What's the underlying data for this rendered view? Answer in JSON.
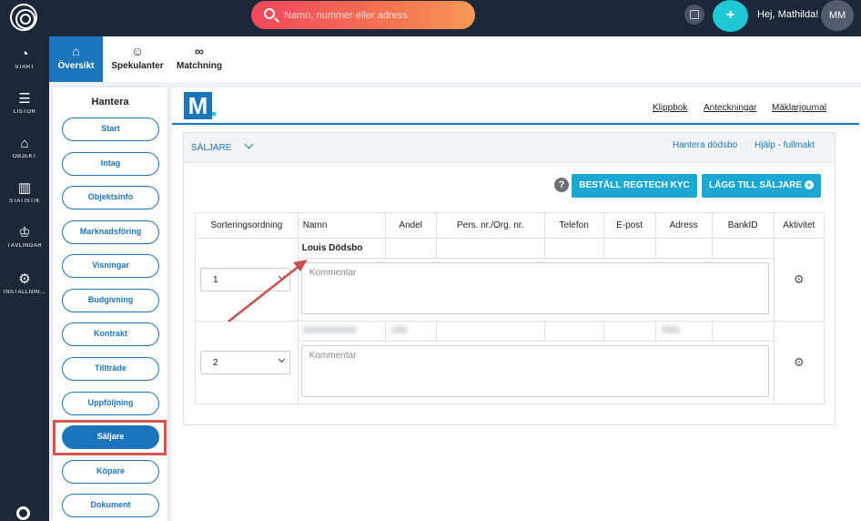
{
  "search": {
    "placeholder": "Namn, nummer eller adress"
  },
  "header": {
    "greeting": "Hej, Mathilda!",
    "initials": "MM",
    "add_label": "+"
  },
  "leftnav": [
    {
      "label": "START",
      "icon": "gauge-icon"
    },
    {
      "label": "LISTOR",
      "icon": "list-icon"
    },
    {
      "label": "OBJEKT",
      "icon": "house-icon"
    },
    {
      "label": "STATISTIK",
      "icon": "bar-chart-icon"
    },
    {
      "label": "TÄVLINGAR",
      "icon": "trophy-icon"
    },
    {
      "label": "INSTÄLLNIN...",
      "icon": "gear-icon"
    }
  ],
  "tabs": [
    {
      "label": "Översikt",
      "active": true
    },
    {
      "label": "Spekulanter"
    },
    {
      "label": "Matchning"
    }
  ],
  "hantera": {
    "title": "Hantera",
    "items": [
      "Start",
      "Intag",
      "Objektsinfo",
      "Marknadsföring",
      "Visningar",
      "Budgivning",
      "Kontrakt",
      "Tillträde",
      "Uppföljning",
      "Säljare",
      "Köpare",
      "Dokument"
    ],
    "active": "Säljare"
  },
  "main": {
    "logo": "M",
    "links": [
      "Klippbok",
      "Anteckningar",
      "Mäklarjournal"
    ],
    "card_title": "SÄLJARE",
    "head_links": [
      "Hantera dödsbo",
      "Hjälp - fullmakt"
    ],
    "buttons": {
      "kyc": "BESTÄLL REGTECH KYC",
      "add": "LÄGG TILL SÄLJARE"
    },
    "columns": [
      "Sorteringsordning",
      "Namn",
      "Andel",
      "Pers. nr./Org. nr.",
      "Telefon",
      "E-post",
      "Adress",
      "BankID",
      "Aktivitet"
    ],
    "rows": [
      {
        "order": "1",
        "name": "Louis Dödsbo",
        "comment_placeholder": "Kommentar"
      },
      {
        "order": "2",
        "name": "",
        "comment_placeholder": "Kommentar"
      }
    ]
  },
  "colors": {
    "primary": "#1c74bb",
    "button": "#1ca8d4",
    "nav": "#1c2738",
    "highlight": "#d9534f"
  }
}
